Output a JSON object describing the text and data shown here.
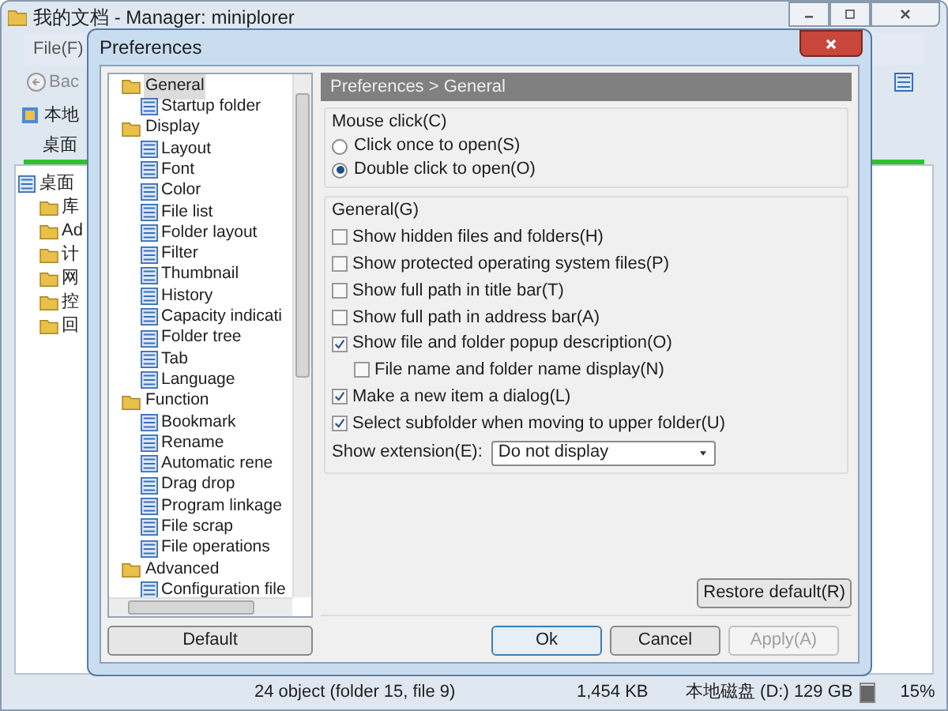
{
  "window": {
    "title": "我的文档 - Manager: miniplorer"
  },
  "menu": [
    "File(F)"
  ],
  "toolbar": {
    "back": "Bac",
    "drive": "本地"
  },
  "tab": "桌面",
  "folder_tree": [
    {
      "label": "桌面",
      "children": [
        {
          "label": "库"
        },
        {
          "label": "Ad"
        },
        {
          "label": "计"
        },
        {
          "label": "网"
        },
        {
          "label": "控"
        },
        {
          "label": "回"
        }
      ]
    }
  ],
  "status_bar": {
    "objects": "24 object (folder 15, file 9)",
    "size": "1,454 KB",
    "drive": "本地磁盘 (D:) 129 GB",
    "level": 0.85,
    "percent": "15%"
  },
  "dialog": {
    "title": "Preferences",
    "tree": [
      {
        "label": "General",
        "selected": true,
        "children": [
          {
            "label": "Startup folder",
            "selected": false
          }
        ]
      },
      {
        "label": "Display",
        "selected": false,
        "children": [
          {
            "label": "Layout",
            "selected": false
          },
          {
            "label": "Font",
            "selected": false
          },
          {
            "label": "Color",
            "selected": false
          },
          {
            "label": "File list",
            "selected": false
          },
          {
            "label": "Folder layout",
            "selected": false
          },
          {
            "label": "Filter",
            "selected": false
          },
          {
            "label": "Thumbnail",
            "selected": false
          },
          {
            "label": "History",
            "selected": false
          },
          {
            "label": "Capacity indicati",
            "selected": false
          },
          {
            "label": "Folder tree",
            "selected": false
          },
          {
            "label": "Tab",
            "selected": false
          },
          {
            "label": "Language",
            "selected": false
          }
        ]
      },
      {
        "label": "Function",
        "selected": false,
        "children": [
          {
            "label": "Bookmark",
            "selected": false
          },
          {
            "label": "Rename",
            "selected": false
          },
          {
            "label": "Automatic rene",
            "selected": false
          },
          {
            "label": "Drag drop",
            "selected": false
          },
          {
            "label": "Program linkage",
            "selected": false
          },
          {
            "label": "File scrap",
            "selected": false
          },
          {
            "label": "File operations",
            "selected": false
          }
        ]
      },
      {
        "label": "Advanced",
        "selected": false,
        "children": [
          {
            "label": "Configuration file",
            "selected": false
          }
        ]
      }
    ],
    "default_button": "Default",
    "header": "Preferences > General",
    "mouse_click": {
      "legend": "Mouse click(C)",
      "options": [
        {
          "label": "Click once to open(S)",
          "selected": false
        },
        {
          "label": "Double click to open(O)",
          "selected": true
        }
      ]
    },
    "general": {
      "legend": "General(G)",
      "options": [
        {
          "label": "Show hidden files and folders(H)",
          "checked": false
        },
        {
          "label": "Show protected operating system files(P)",
          "checked": false
        },
        {
          "label": "Show full path in title bar(T)",
          "checked": false
        },
        {
          "label": "Show full path in address bar(A)",
          "checked": false
        },
        {
          "label": "Show file and folder popup description(O)",
          "checked": true,
          "children": [
            {
              "label": "File name and folder name display(N)",
              "checked": false
            }
          ]
        },
        {
          "label": "Make a new item a dialog(L)",
          "checked": true
        },
        {
          "label": "Select subfolder when moving to upper folder(U)",
          "checked": true
        }
      ],
      "extension": {
        "label": "Show extension(E):",
        "value": "Do not display"
      }
    },
    "restore_button": "Restore default(R)",
    "buttons": [
      {
        "label": "Ok",
        "disabled": false
      },
      {
        "label": "Cancel",
        "disabled": false
      },
      {
        "label": "Apply(A)",
        "disabled": true
      }
    ]
  }
}
